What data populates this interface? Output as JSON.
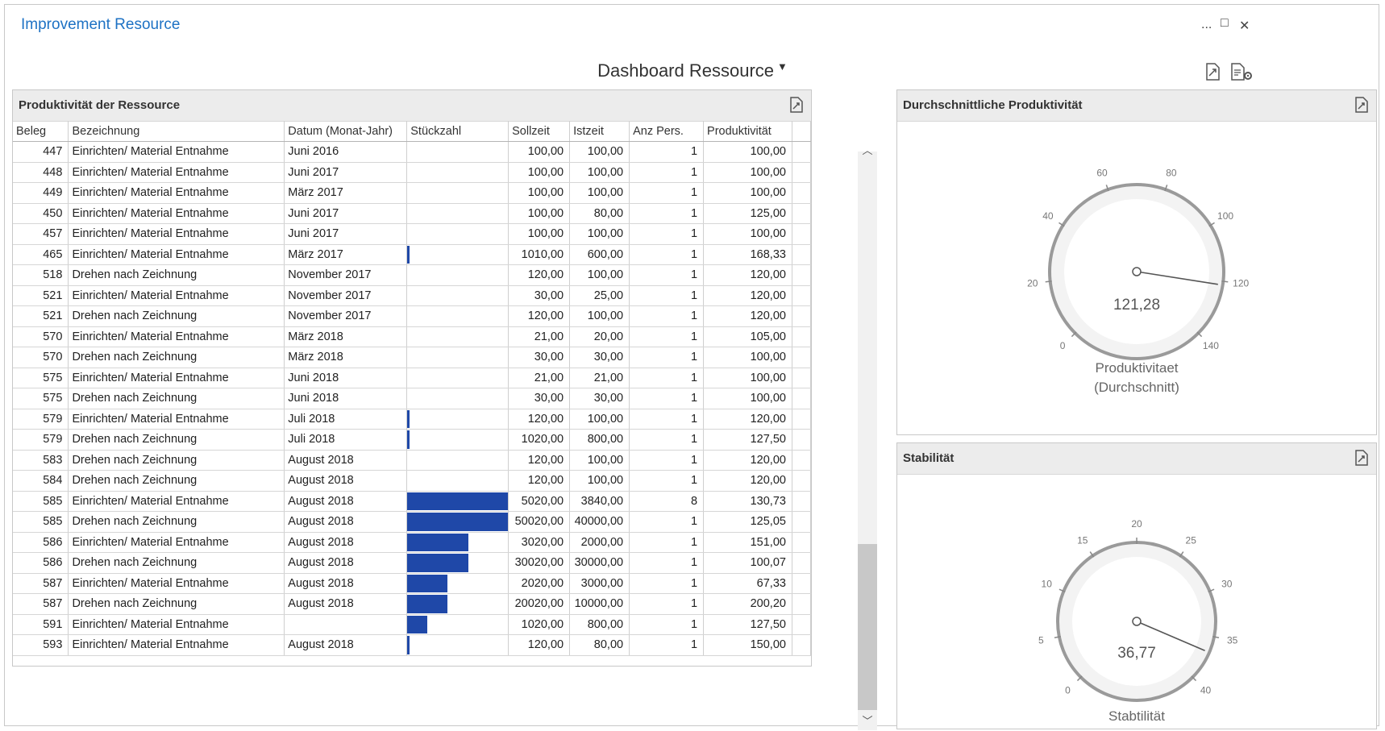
{
  "app": {
    "title": "Improvement Resource",
    "window_controls": [
      "...",
      "□",
      "✕"
    ]
  },
  "dashboard": {
    "title": "Dashboard Ressource",
    "filter_icon": "filter-icon"
  },
  "grid_panel": {
    "title": "Produktivität der Ressource",
    "columns": [
      "Beleg",
      "Bezeichnung",
      "Datum (Monat-Jahr)",
      "Stückzahl",
      "Sollzeit",
      "Istzeit",
      "Anz Pers.",
      "Produktivität"
    ],
    "rows": [
      {
        "beleg": "447",
        "bez": "Einrichten/ Material Entnahme",
        "datum": "Juni 2016",
        "stk": 0.0,
        "soll": "100,00",
        "ist": "100,00",
        "anz": "1",
        "prod": "100,00"
      },
      {
        "beleg": "448",
        "bez": "Einrichten/ Material Entnahme",
        "datum": "Juni 2017",
        "stk": 0.0,
        "soll": "100,00",
        "ist": "100,00",
        "anz": "1",
        "prod": "100,00"
      },
      {
        "beleg": "449",
        "bez": "Einrichten/ Material Entnahme",
        "datum": "März 2017",
        "stk": 0.0,
        "soll": "100,00",
        "ist": "100,00",
        "anz": "1",
        "prod": "100,00"
      },
      {
        "beleg": "450",
        "bez": "Einrichten/ Material Entnahme",
        "datum": "Juni 2017",
        "stk": 0.0,
        "soll": "100,00",
        "ist": "80,00",
        "anz": "1",
        "prod": "125,00"
      },
      {
        "beleg": "457",
        "bez": "Einrichten/ Material Entnahme",
        "datum": "Juni 2017",
        "stk": 0.0,
        "soll": "100,00",
        "ist": "100,00",
        "anz": "1",
        "prod": "100,00"
      },
      {
        "beleg": "465",
        "bez": "Einrichten/ Material Entnahme",
        "datum": "März 2017",
        "stk": 0.02,
        "soll": "1010,00",
        "ist": "600,00",
        "anz": "1",
        "prod": "168,33"
      },
      {
        "beleg": "518",
        "bez": "Drehen nach Zeichnung",
        "datum": "November 2017",
        "stk": 0.0,
        "soll": "120,00",
        "ist": "100,00",
        "anz": "1",
        "prod": "120,00"
      },
      {
        "beleg": "521",
        "bez": "Einrichten/ Material Entnahme",
        "datum": "November 2017",
        "stk": 0.0,
        "soll": "30,00",
        "ist": "25,00",
        "anz": "1",
        "prod": "120,00"
      },
      {
        "beleg": "521",
        "bez": "Drehen nach Zeichnung",
        "datum": "November 2017",
        "stk": 0.0,
        "soll": "120,00",
        "ist": "100,00",
        "anz": "1",
        "prod": "120,00"
      },
      {
        "beleg": "570",
        "bez": "Einrichten/ Material Entnahme",
        "datum": "März 2018",
        "stk": 0.0,
        "soll": "21,00",
        "ist": "20,00",
        "anz": "1",
        "prod": "105,00"
      },
      {
        "beleg": "570",
        "bez": "Drehen nach Zeichnung",
        "datum": "März 2018",
        "stk": 0.0,
        "soll": "30,00",
        "ist": "30,00",
        "anz": "1",
        "prod": "100,00"
      },
      {
        "beleg": "575",
        "bez": "Einrichten/ Material Entnahme",
        "datum": "Juni 2018",
        "stk": 0.0,
        "soll": "21,00",
        "ist": "21,00",
        "anz": "1",
        "prod": "100,00"
      },
      {
        "beleg": "575",
        "bez": "Drehen nach Zeichnung",
        "datum": "Juni 2018",
        "stk": 0.0,
        "soll": "30,00",
        "ist": "30,00",
        "anz": "1",
        "prod": "100,00"
      },
      {
        "beleg": "579",
        "bez": "Einrichten/ Material Entnahme",
        "datum": "Juli 2018",
        "stk": 0.02,
        "soll": "120,00",
        "ist": "100,00",
        "anz": "1",
        "prod": "120,00"
      },
      {
        "beleg": "579",
        "bez": "Drehen nach Zeichnung",
        "datum": "Juli 2018",
        "stk": 0.02,
        "soll": "1020,00",
        "ist": "800,00",
        "anz": "1",
        "prod": "127,50"
      },
      {
        "beleg": "583",
        "bez": "Drehen nach Zeichnung",
        "datum": "August 2018",
        "stk": 0.0,
        "soll": "120,00",
        "ist": "100,00",
        "anz": "1",
        "prod": "120,00"
      },
      {
        "beleg": "584",
        "bez": "Drehen nach Zeichnung",
        "datum": "August 2018",
        "stk": 0.0,
        "soll": "120,00",
        "ist": "100,00",
        "anz": "1",
        "prod": "120,00"
      },
      {
        "beleg": "585",
        "bez": "Einrichten/ Material Entnahme",
        "datum": "August 2018",
        "stk": 1.0,
        "soll": "5020,00",
        "ist": "3840,00",
        "anz": "8",
        "prod": "130,73"
      },
      {
        "beleg": "585",
        "bez": "Drehen nach Zeichnung",
        "datum": "August 2018",
        "stk": 1.0,
        "soll": "50020,00",
        "ist": "40000,00",
        "anz": "1",
        "prod": "125,05"
      },
      {
        "beleg": "586",
        "bez": "Einrichten/ Material Entnahme",
        "datum": "August 2018",
        "stk": 0.6,
        "soll": "3020,00",
        "ist": "2000,00",
        "anz": "1",
        "prod": "151,00"
      },
      {
        "beleg": "586",
        "bez": "Drehen nach Zeichnung",
        "datum": "August 2018",
        "stk": 0.6,
        "soll": "30020,00",
        "ist": "30000,00",
        "anz": "1",
        "prod": "100,07"
      },
      {
        "beleg": "587",
        "bez": "Einrichten/ Material Entnahme",
        "datum": "August 2018",
        "stk": 0.4,
        "soll": "2020,00",
        "ist": "3000,00",
        "anz": "1",
        "prod": "67,33"
      },
      {
        "beleg": "587",
        "bez": "Drehen nach Zeichnung",
        "datum": "August 2018",
        "stk": 0.4,
        "soll": "20020,00",
        "ist": "10000,00",
        "anz": "1",
        "prod": "200,20"
      },
      {
        "beleg": "591",
        "bez": "Einrichten/ Material Entnahme",
        "datum": "",
        "stk": 0.2,
        "soll": "1020,00",
        "ist": "800,00",
        "anz": "1",
        "prod": "127,50"
      },
      {
        "beleg": "593",
        "bez": "Einrichten/ Material Entnahme",
        "datum": "August 2018",
        "stk": 0.02,
        "soll": "120,00",
        "ist": "80,00",
        "anz": "1",
        "prod": "150,00"
      }
    ],
    "bar_color": "#1f48a8"
  },
  "gauge_avg": {
    "title": "Durchschnittliche Produktivität",
    "value": 121.28,
    "value_label": "121,28",
    "min": 0,
    "max": 140,
    "ticks": [
      "0",
      "20",
      "40",
      "60",
      "80",
      "100",
      "120",
      "140"
    ],
    "caption_line1": "Produktivitaet",
    "caption_line2": "(Durchschnitt)"
  },
  "gauge_stab": {
    "title": "Stabilität",
    "value": 36.77,
    "value_label": "36,77",
    "min": 0,
    "max": 40,
    "ticks": [
      "0",
      "5",
      "10",
      "15",
      "20",
      "25",
      "30",
      "35",
      "40"
    ],
    "caption_line1": "Stabtilität"
  },
  "colors": {
    "accent": "#1e72c4",
    "panel_header": "#ececec"
  }
}
